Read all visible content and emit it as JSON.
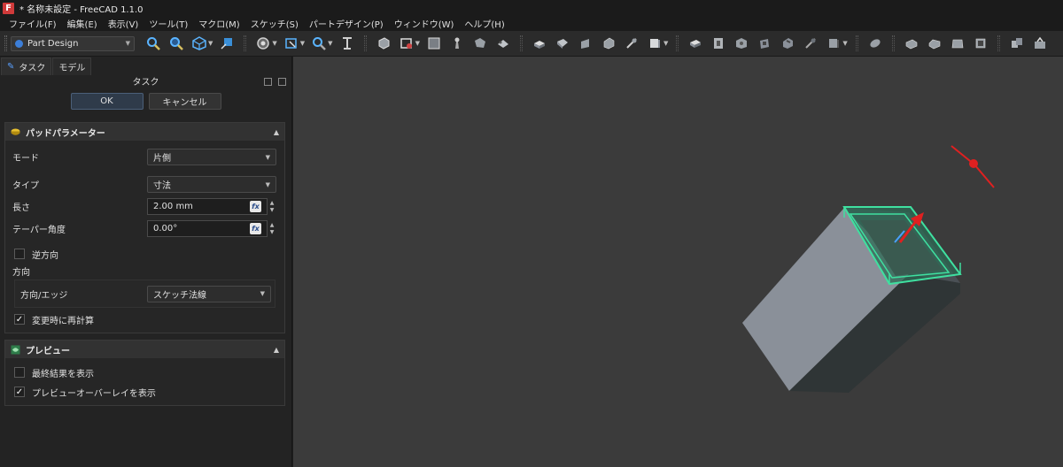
{
  "window": {
    "icon_letter": "F",
    "title": "* 名称未設定 - FreeCAD 1.1.0"
  },
  "menu": [
    "ファイル(F)",
    "編集(E)",
    "表示(V)",
    "ツール(T)",
    "マクロ(M)",
    "スケッチ(S)",
    "パートデザイン(P)",
    "ウィンドウ(W)",
    "ヘルプ(H)"
  ],
  "toolbar": {
    "workbench": "Part Design"
  },
  "tabs": {
    "task": "タスク",
    "model": "モデル"
  },
  "task_panel": {
    "title": "タスク",
    "ok_label": "OK",
    "cancel_label": "キャンセル"
  },
  "pad_params": {
    "title": "パッドパラメーター",
    "mode_label": "モード",
    "mode_value": "片側",
    "type_label": "タイプ",
    "type_value": "寸法",
    "length_label": "長さ",
    "length_value": "2.00 mm",
    "taper_label": "テーパー角度",
    "taper_value": "0.00°",
    "reversed_label": "逆方向",
    "reversed_checked": false,
    "direction_label": "方向",
    "direction_edge_label": "方向/エッジ",
    "direction_edge_value": "スケッチ法線",
    "recompute_label": "変更時に再計算",
    "recompute_checked": true
  },
  "preview": {
    "title": "プレビュー",
    "show_final_label": "最終結果を表示",
    "show_final_checked": false,
    "show_overlay_label": "プレビューオーバーレイを表示",
    "show_overlay_checked": true
  },
  "colors": {
    "viewport_bg": "#3b3b3b",
    "solid_light": "#8a9099",
    "solid_dark": "#2f3536",
    "preview_green": "#3fe0a0",
    "direction_red": "#e02020"
  }
}
